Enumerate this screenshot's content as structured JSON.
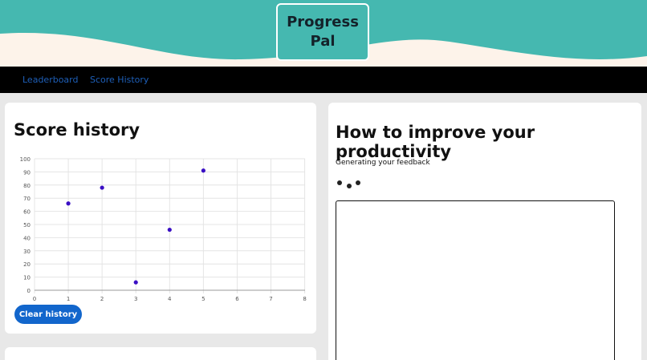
{
  "header": {
    "brand_line1": "Progress",
    "brand_line2": "Pal"
  },
  "nav": {
    "items": [
      {
        "label": "Leaderboard"
      },
      {
        "label": "Score History"
      }
    ]
  },
  "score_history": {
    "title": "Score history",
    "clear_label": "Clear history"
  },
  "improve": {
    "title": "How to improve your productivity",
    "status": "Generating your feedback",
    "feedback_value": ""
  },
  "colors": {
    "teal": "#45b8b0",
    "cream": "#fdf3ea",
    "nav_bg": "#000000",
    "link": "#1e5fb8",
    "button": "#1266cc",
    "point": "#3a0fc4"
  },
  "chart_data": {
    "type": "scatter",
    "x": [
      1,
      2,
      3,
      4,
      5
    ],
    "y": [
      66,
      78,
      6,
      46,
      91
    ],
    "xlim": [
      0,
      8
    ],
    "ylim": [
      0,
      100
    ],
    "x_ticks": [
      0,
      1,
      2,
      3,
      4,
      5,
      6,
      7,
      8
    ],
    "y_ticks": [
      0,
      10,
      20,
      30,
      40,
      50,
      60,
      70,
      80,
      90,
      100
    ],
    "grid": true
  }
}
